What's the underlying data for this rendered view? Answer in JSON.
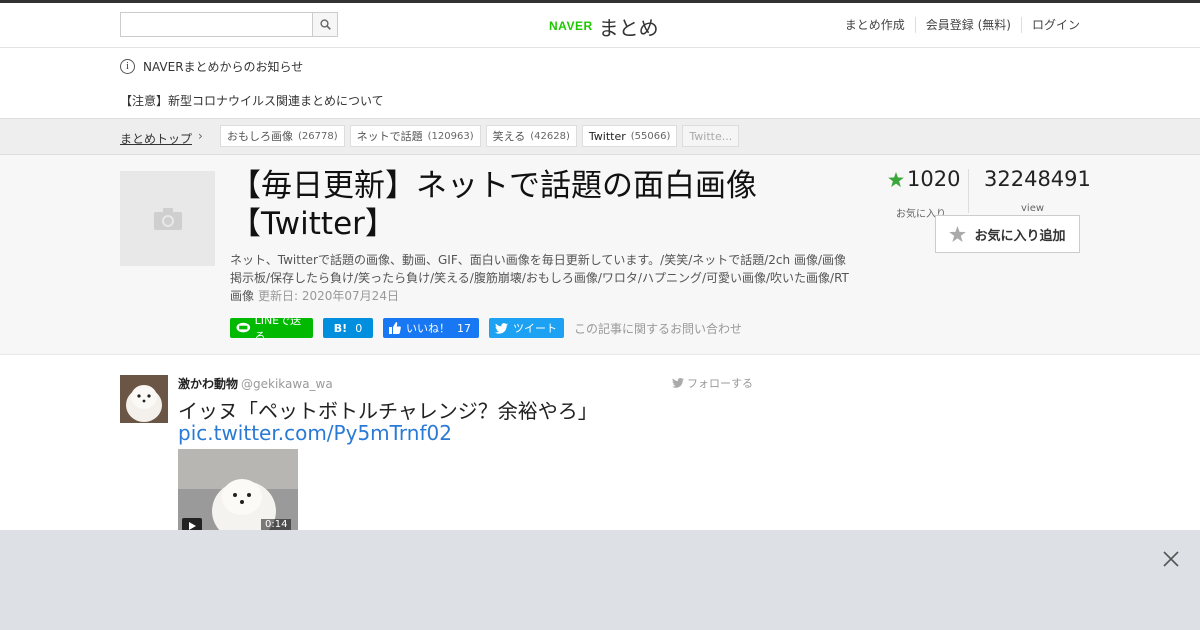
{
  "header": {
    "search": {
      "value": "",
      "placeholder": ""
    },
    "logo": {
      "brand": "NAVER",
      "service": "まとめ"
    },
    "links": [
      "まとめ作成",
      "会員登録 (無料)",
      "ログイン"
    ]
  },
  "notice": {
    "heading": "NAVERまとめからのお知らせ",
    "link": "【注意】新型コロナウイルス関連まとめについて"
  },
  "breadcrumb": {
    "top": "まとめトップ",
    "tags": [
      {
        "label": "おもしろ画像",
        "count": "(26778)"
      },
      {
        "label": "ネットで話題",
        "count": "(120963)"
      },
      {
        "label": "笑える",
        "count": "(42628)"
      },
      {
        "label": "Twitter",
        "count": "(55066)"
      },
      {
        "label": "Twitte...",
        "count": ""
      }
    ]
  },
  "article": {
    "title": "【毎日更新】ネットで話題の面白画像【Twitter】",
    "description": "ネット、Twitterで話題の画像、動画、GIF、面白い画像を毎日更新しています。/笑笑/ネットで話題/2ch 画像/画像掲示板/保存したら負け/笑ったら負け/笑える/腹筋崩壊/おもしろ画像/ワロタ/ハプニング/可愛い画像/吹いた画像/RT画像",
    "updated": "更新日: 2020年07月24日",
    "favorites": "1020",
    "favorites_label": "お気に入り",
    "views": "32248491",
    "views_label": "view",
    "fav_button": "お気に入り追加",
    "share": {
      "line": "LINEで送る",
      "hatena_count": "0",
      "facebook": "いいね！",
      "facebook_count": "17",
      "twitter": "ツイート"
    },
    "contact": "この記事に関するお問い合わせ"
  },
  "tweet": {
    "name": "激かわ動物",
    "handle": "@gekikawa_wa",
    "follow": "フォローする",
    "text": "イッヌ「ペットボトルチャレンジ？余裕やろ」",
    "link": "pic.twitter.com/Py5mTrnf02",
    "duration": "0:14"
  },
  "colors": {
    "naver_green": "#1ec800",
    "line_green": "#00b900",
    "hatena_blue": "#008fde",
    "facebook_blue": "#1877f2",
    "twitter_blue": "#1da1f2",
    "link_blue": "#2a7ad5",
    "star_green": "#3aa63a"
  }
}
